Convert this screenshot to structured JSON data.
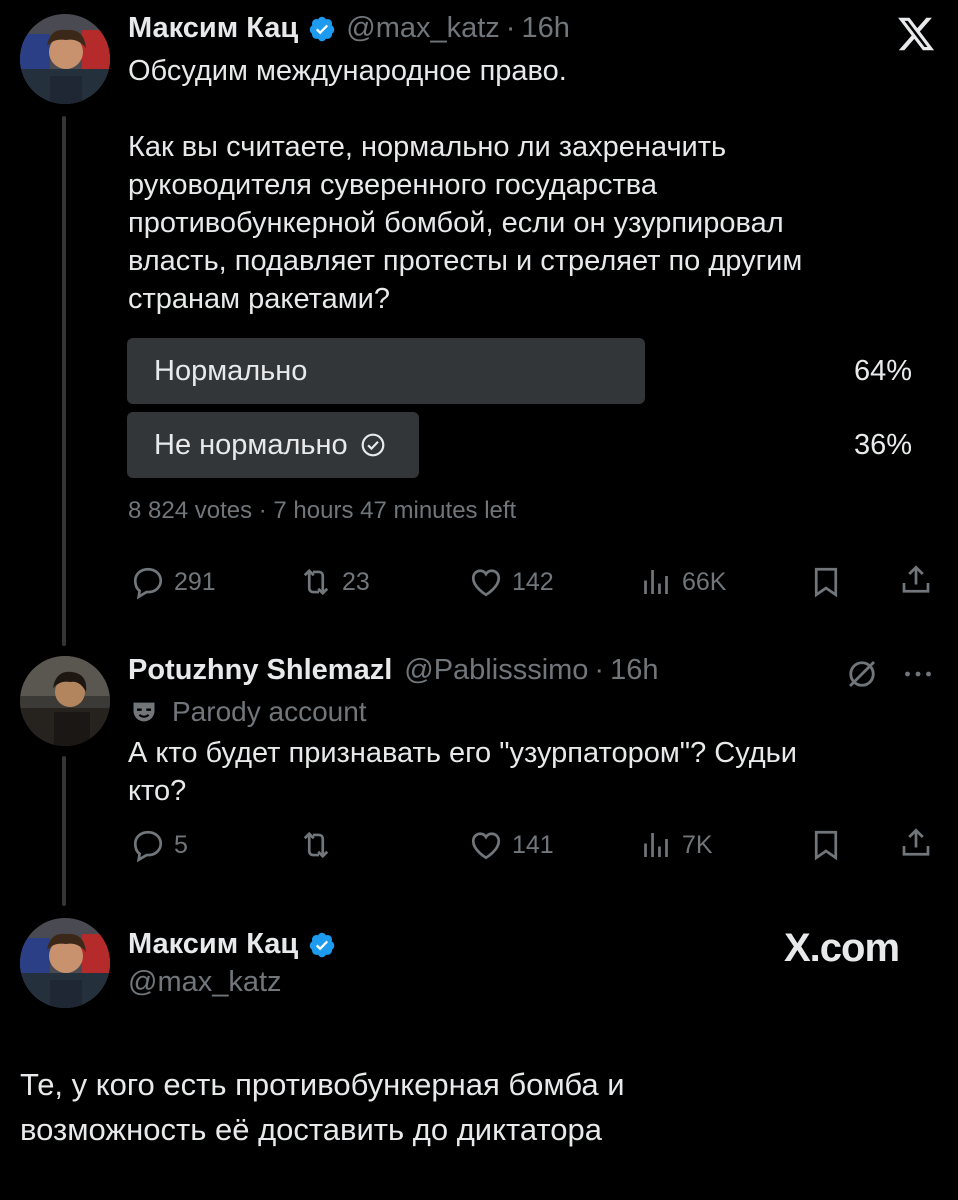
{
  "tweet1": {
    "name": "Максим Кац",
    "handle": "@max_katz",
    "dot": "·",
    "time": "16h",
    "line1": "Обсудим международное право.",
    "body": "Как вы считаете, нормально ли захреначить\nруководителя суверенного государства\nпротивобункерной бомбой, если он узурпировал\nвласть, подавляет протесты и стреляет по другим\nстранам ракетами?",
    "poll": {
      "options": [
        {
          "label": "Нормально",
          "pct": "64%",
          "fraction": 0.64,
          "voted": false
        },
        {
          "label": "Не нормально",
          "pct": "36%",
          "fraction": 0.36,
          "voted": true
        }
      ],
      "meta": "8 824 votes · 7 hours 47 minutes left"
    },
    "actions": {
      "replies": "291",
      "reposts": "23",
      "likes": "142",
      "views": "66K"
    }
  },
  "reply": {
    "name": "Potuzhny Shlemazl",
    "handle": "@Pablisssimo",
    "dot": "·",
    "time": "16h",
    "badge": "Parody account",
    "body": "А кто будет признавать его \"узурпатором\"? Судьи\nкто?",
    "actions": {
      "replies": "5",
      "reposts": "",
      "likes": "141",
      "views": "7K"
    }
  },
  "quote": {
    "name": "Максим Кац",
    "handle": "@max_katz",
    "brand": "X.com",
    "body": "Те, у кого есть противобункерная бомба и\nвозможность её доставить до диктатора"
  },
  "colors": {
    "background": "#000000",
    "text": "#e7e9ea",
    "muted": "#71767b",
    "verified": "#1d9bf0",
    "poll_bar": "#333639"
  },
  "icons": [
    "x-logo-icon",
    "verified-icon",
    "reply-icon",
    "repost-icon",
    "like-icon",
    "views-icon",
    "bookmark-icon",
    "share-icon",
    "check-circle-icon",
    "grok-icon",
    "more-icon",
    "parody-mask-icon"
  ]
}
